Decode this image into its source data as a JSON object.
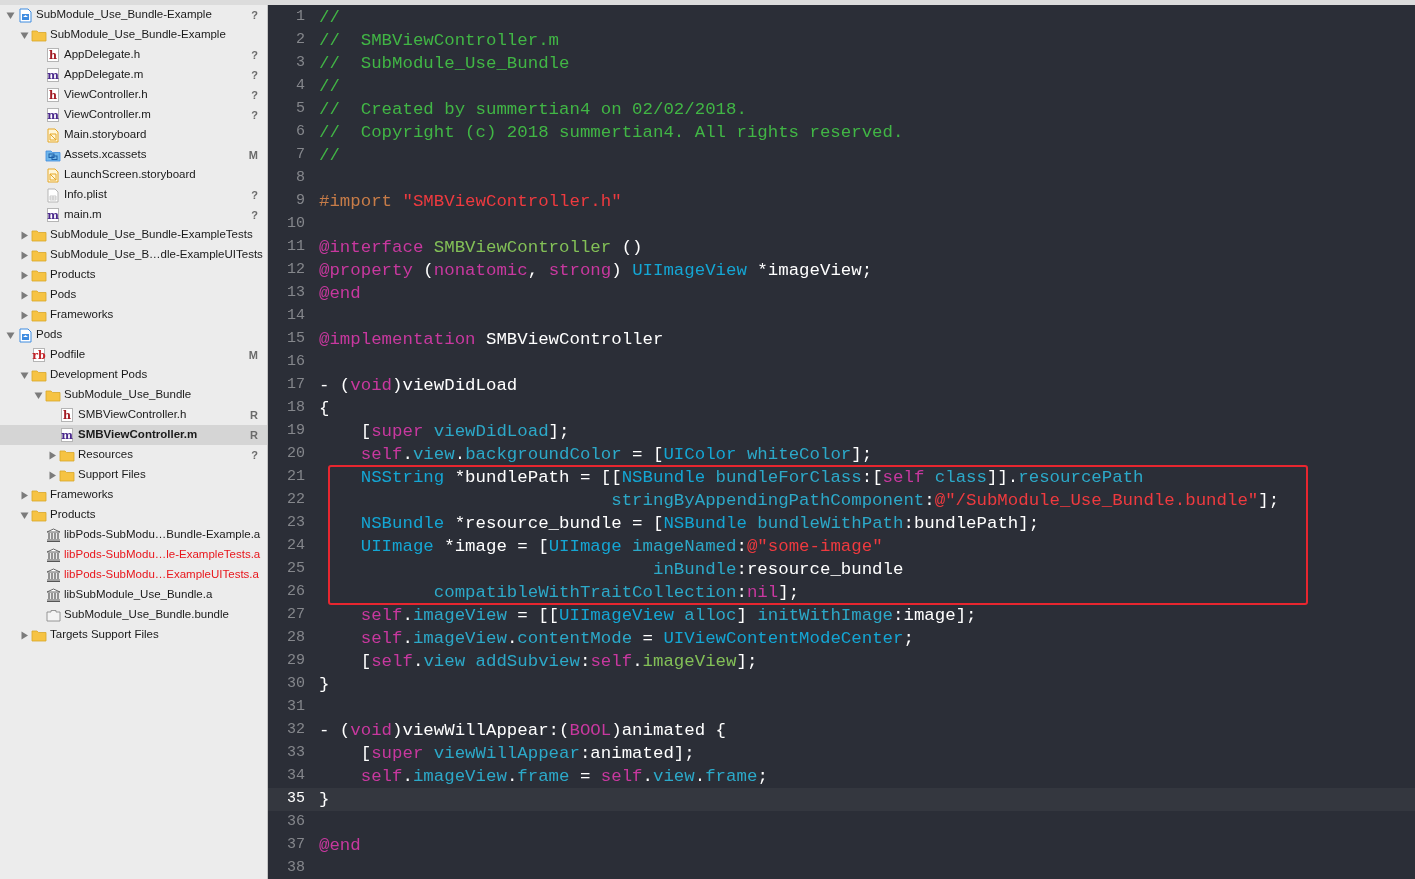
{
  "sidebar": {
    "items": [
      {
        "label": "SubModule_Use_Bundle-Example",
        "kind": "project",
        "badge": "?",
        "expanded": true,
        "selected": false,
        "children": [
          {
            "label": "SubModule_Use_Bundle-Example",
            "kind": "folder",
            "expanded": true,
            "selected": false,
            "children": [
              {
                "label": "AppDelegate.h",
                "kind": "h",
                "glyph": "h",
                "badge": "?",
                "selected": false
              },
              {
                "label": "AppDelegate.m",
                "kind": "m",
                "glyph": "m",
                "badge": "?",
                "selected": false
              },
              {
                "label": "ViewController.h",
                "kind": "h",
                "glyph": "h",
                "badge": "?",
                "selected": false
              },
              {
                "label": "ViewController.m",
                "kind": "m",
                "glyph": "m",
                "badge": "?",
                "selected": false
              },
              {
                "label": "Main.storyboard",
                "kind": "storyboard",
                "selected": false
              },
              {
                "label": "Assets.xcassets",
                "kind": "xcassets",
                "badge": "M",
                "selected": false
              },
              {
                "label": "LaunchScreen.storyboard",
                "kind": "storyboard",
                "selected": false
              },
              {
                "label": "Info.plist",
                "kind": "plist",
                "badge": "?",
                "selected": false
              },
              {
                "label": "main.m",
                "kind": "m",
                "glyph": "m",
                "badge": "?",
                "selected": false
              }
            ]
          },
          {
            "label": "SubModule_Use_Bundle-ExampleTests",
            "kind": "folder",
            "expanded": false,
            "selected": false
          },
          {
            "label": "SubModule_Use_B…dle-ExampleUITests",
            "kind": "folder",
            "expanded": false,
            "selected": false
          },
          {
            "label": "Products",
            "kind": "folder",
            "expanded": false,
            "selected": false
          },
          {
            "label": "Pods",
            "kind": "folder",
            "expanded": false,
            "selected": false
          },
          {
            "label": "Frameworks",
            "kind": "folder",
            "expanded": false,
            "selected": false
          }
        ]
      },
      {
        "label": "Pods",
        "kind": "project",
        "expanded": true,
        "selected": false,
        "children": [
          {
            "label": "Podfile",
            "kind": "rb",
            "glyph": "rb",
            "badge": "M",
            "selected": false
          },
          {
            "label": "Development Pods",
            "kind": "folder",
            "expanded": true,
            "selected": false,
            "children": [
              {
                "label": "SubModule_Use_Bundle",
                "kind": "folder",
                "expanded": true,
                "selected": false,
                "children": [
                  {
                    "label": "SMBViewController.h",
                    "kind": "h",
                    "glyph": "h",
                    "badge": "R",
                    "selected": false
                  },
                  {
                    "label": "SMBViewController.m",
                    "kind": "m",
                    "glyph": "m",
                    "badge": "R",
                    "selected": true
                  },
                  {
                    "label": "Resources",
                    "kind": "folder",
                    "badge": "?",
                    "expanded": false,
                    "selected": false
                  },
                  {
                    "label": "Support Files",
                    "kind": "folder",
                    "expanded": false,
                    "selected": false
                  }
                ]
              }
            ]
          },
          {
            "label": "Frameworks",
            "kind": "folder",
            "expanded": false,
            "selected": false
          },
          {
            "label": "Products",
            "kind": "folder",
            "expanded": true,
            "selected": false,
            "children": [
              {
                "label": "libPods-SubModu…Bundle-Example.a",
                "kind": "library",
                "missing": false,
                "selected": false
              },
              {
                "label": "libPods-SubModu…le-ExampleTests.a",
                "kind": "library",
                "missing": true,
                "selected": false
              },
              {
                "label": "libPods-SubModu…ExampleUITests.a",
                "kind": "library",
                "missing": true,
                "selected": false
              },
              {
                "label": "libSubModule_Use_Bundle.a",
                "kind": "library",
                "missing": false,
                "selected": false
              },
              {
                "label": "SubModule_Use_Bundle.bundle",
                "kind": "bundle",
                "missing": false,
                "selected": false
              }
            ]
          },
          {
            "label": "Targets Support Files",
            "kind": "folder",
            "expanded": false,
            "selected": false
          }
        ]
      }
    ]
  },
  "editor": {
    "blocks": [
      {
        "boxed": false,
        "lines": [
          {
            "number": "1",
            "current": false,
            "tokens": [
              {
                "kind": "comment",
                "text": "//"
              }
            ]
          },
          {
            "number": "2",
            "current": false,
            "tokens": [
              {
                "kind": "comment",
                "text": "//  SMBViewController.m"
              }
            ]
          },
          {
            "number": "3",
            "current": false,
            "tokens": [
              {
                "kind": "comment",
                "text": "//  SubModule_Use_Bundle"
              }
            ]
          },
          {
            "number": "4",
            "current": false,
            "tokens": [
              {
                "kind": "comment",
                "text": "//"
              }
            ]
          },
          {
            "number": "5",
            "current": false,
            "tokens": [
              {
                "kind": "comment",
                "text": "//  Created by summertian4 on 02/02/2018."
              }
            ]
          },
          {
            "number": "6",
            "current": false,
            "tokens": [
              {
                "kind": "comment",
                "text": "//  Copyright (c) 2018 summertian4. All rights reserved."
              }
            ]
          },
          {
            "number": "7",
            "current": false,
            "tokens": [
              {
                "kind": "comment",
                "text": "//"
              }
            ]
          },
          {
            "number": "8",
            "current": false
          },
          {
            "number": "9",
            "current": false,
            "tokens": [
              {
                "kind": "preprocessor",
                "text": "#import"
              },
              {
                "kind": "string",
                "text": " \"SMBViewController.h\""
              }
            ]
          },
          {
            "number": "10",
            "current": false
          },
          {
            "number": "11",
            "current": false,
            "tokens": [
              {
                "kind": "keyword",
                "text": "@interface"
              },
              {
                "kind": "project",
                "text": " SMBViewController"
              },
              {
                "kind": "plain",
                "text": " ()"
              }
            ]
          },
          {
            "number": "12",
            "current": false,
            "tokens": [
              {
                "kind": "keyword",
                "text": "@property"
              },
              {
                "kind": "plain",
                "text": " ("
              },
              {
                "kind": "keyword",
                "text": "nonatomic"
              },
              {
                "kind": "plain",
                "text": ", "
              },
              {
                "kind": "keyword",
                "text": "strong"
              },
              {
                "kind": "plain",
                "text": ") "
              },
              {
                "kind": "type",
                "text": "UIImageView"
              },
              {
                "kind": "plain",
                "text": " *imageView;"
              }
            ]
          },
          {
            "number": "13",
            "current": false,
            "tokens": [
              {
                "kind": "keyword",
                "text": "@end"
              }
            ]
          },
          {
            "number": "14",
            "current": false
          },
          {
            "number": "15",
            "current": false,
            "tokens": [
              {
                "kind": "keyword",
                "text": "@implementation"
              },
              {
                "kind": "plain",
                "text": " SMBViewController"
              }
            ]
          },
          {
            "number": "16",
            "current": false
          },
          {
            "number": "17",
            "current": false,
            "tokens": [
              {
                "kind": "plain",
                "text": "- ("
              },
              {
                "kind": "keyword",
                "text": "void"
              },
              {
                "kind": "plain",
                "text": ")viewDidLoad"
              }
            ]
          },
          {
            "number": "18",
            "current": false,
            "tokens": [
              {
                "kind": "plain",
                "text": "{"
              }
            ]
          },
          {
            "number": "19",
            "current": false,
            "tokens": [
              {
                "kind": "plain",
                "text": "    ["
              },
              {
                "kind": "keyword",
                "text": "super"
              },
              {
                "kind": "method",
                "text": " viewDidLoad"
              },
              {
                "kind": "plain",
                "text": "];"
              }
            ]
          },
          {
            "number": "20",
            "current": false,
            "tokens": [
              {
                "kind": "keyword",
                "text": "    self"
              },
              {
                "kind": "plain",
                "text": "."
              },
              {
                "kind": "method",
                "text": "view"
              },
              {
                "kind": "plain",
                "text": "."
              },
              {
                "kind": "method",
                "text": "backgroundColor"
              },
              {
                "kind": "plain",
                "text": " = ["
              },
              {
                "kind": "type",
                "text": "UIColor"
              },
              {
                "kind": "method",
                "text": " whiteColor"
              },
              {
                "kind": "plain",
                "text": "];"
              }
            ]
          }
        ]
      },
      {
        "boxed": true,
        "lines": [
          {
            "number": "21",
            "current": false,
            "tokens": [
              {
                "kind": "type",
                "text": "    NSString"
              },
              {
                "kind": "plain",
                "text": " *bundlePath = [["
              },
              {
                "kind": "type",
                "text": "NSBundle"
              },
              {
                "kind": "method",
                "text": " bundleForClass"
              },
              {
                "kind": "plain",
                "text": ":["
              },
              {
                "kind": "keyword",
                "text": "self"
              },
              {
                "kind": "method",
                "text": " class"
              },
              {
                "kind": "plain",
                "text": "]]."
              },
              {
                "kind": "method",
                "text": "resourcePath"
              }
            ]
          },
          {
            "number": "22",
            "current": false,
            "tokens": [
              {
                "kind": "method",
                "text": "                            stringByAppendingPathComponent"
              },
              {
                "kind": "plain",
                "text": ":"
              },
              {
                "kind": "string",
                "text": "@\"/SubModule_Use_Bundle.bundle\""
              },
              {
                "kind": "plain",
                "text": "];"
              }
            ]
          },
          {
            "number": "23",
            "current": false,
            "tokens": [
              {
                "kind": "type",
                "text": "    NSBundle"
              },
              {
                "kind": "plain",
                "text": " *resource_bundle = ["
              },
              {
                "kind": "type",
                "text": "NSBundle"
              },
              {
                "kind": "method",
                "text": " bundleWithPath"
              },
              {
                "kind": "plain",
                "text": ":bundlePath];"
              }
            ]
          },
          {
            "number": "24",
            "current": false,
            "tokens": [
              {
                "kind": "type",
                "text": "    UIImage"
              },
              {
                "kind": "plain",
                "text": " *image = ["
              },
              {
                "kind": "type",
                "text": "UIImage"
              },
              {
                "kind": "method",
                "text": " imageNamed"
              },
              {
                "kind": "plain",
                "text": ":"
              },
              {
                "kind": "string",
                "text": "@\"some-image\""
              }
            ]
          },
          {
            "number": "25",
            "current": false,
            "tokens": [
              {
                "kind": "method",
                "text": "                                inBundle"
              },
              {
                "kind": "plain",
                "text": ":resource_bundle"
              }
            ]
          },
          {
            "number": "26",
            "current": false,
            "tokens": [
              {
                "kind": "method",
                "text": "           compatibleWithTraitCollection"
              },
              {
                "kind": "plain",
                "text": ":"
              },
              {
                "kind": "keyword",
                "text": "nil"
              },
              {
                "kind": "plain",
                "text": "];"
              }
            ]
          }
        ]
      },
      {
        "boxed": false,
        "lines": [
          {
            "number": "27",
            "current": false,
            "tokens": [
              {
                "kind": "keyword",
                "text": "    self"
              },
              {
                "kind": "plain",
                "text": "."
              },
              {
                "kind": "method",
                "text": "imageView"
              },
              {
                "kind": "plain",
                "text": " = [["
              },
              {
                "kind": "type",
                "text": "UIImageView"
              },
              {
                "kind": "method",
                "text": " alloc"
              },
              {
                "kind": "plain",
                "text": "] "
              },
              {
                "kind": "method",
                "text": "initWithImage"
              },
              {
                "kind": "plain",
                "text": ":image];"
              }
            ]
          },
          {
            "number": "28",
            "current": false,
            "tokens": [
              {
                "kind": "keyword",
                "text": "    self"
              },
              {
                "kind": "plain",
                "text": "."
              },
              {
                "kind": "method",
                "text": "imageView"
              },
              {
                "kind": "plain",
                "text": "."
              },
              {
                "kind": "method",
                "text": "contentMode"
              },
              {
                "kind": "plain",
                "text": " = "
              },
              {
                "kind": "type",
                "text": "UIViewContentModeCenter"
              },
              {
                "kind": "plain",
                "text": ";"
              }
            ]
          },
          {
            "number": "29",
            "current": false,
            "tokens": [
              {
                "kind": "plain",
                "text": "    ["
              },
              {
                "kind": "keyword",
                "text": "self"
              },
              {
                "kind": "plain",
                "text": "."
              },
              {
                "kind": "method",
                "text": "view"
              },
              {
                "kind": "method",
                "text": " addSubview"
              },
              {
                "kind": "plain",
                "text": ":"
              },
              {
                "kind": "keyword",
                "text": "self"
              },
              {
                "kind": "plain",
                "text": "."
              },
              {
                "kind": "project",
                "text": "imageView"
              },
              {
                "kind": "plain",
                "text": "];"
              }
            ]
          },
          {
            "number": "30",
            "current": false,
            "tokens": [
              {
                "kind": "plain",
                "text": "}"
              }
            ]
          },
          {
            "number": "31",
            "current": false
          },
          {
            "number": "32",
            "current": false,
            "tokens": [
              {
                "kind": "plain",
                "text": "- ("
              },
              {
                "kind": "keyword",
                "text": "void"
              },
              {
                "kind": "plain",
                "text": ")viewWillAppear:("
              },
              {
                "kind": "keyword",
                "text": "BOOL"
              },
              {
                "kind": "plain",
                "text": ")animated {"
              }
            ]
          },
          {
            "number": "33",
            "current": false,
            "tokens": [
              {
                "kind": "plain",
                "text": "    ["
              },
              {
                "kind": "keyword",
                "text": "super"
              },
              {
                "kind": "method",
                "text": " viewWillAppear"
              },
              {
                "kind": "plain",
                "text": ":animated];"
              }
            ]
          },
          {
            "number": "34",
            "current": false,
            "tokens": [
              {
                "kind": "keyword",
                "text": "    self"
              },
              {
                "kind": "plain",
                "text": "."
              },
              {
                "kind": "method",
                "text": "imageView"
              },
              {
                "kind": "plain",
                "text": "."
              },
              {
                "kind": "method",
                "text": "frame"
              },
              {
                "kind": "plain",
                "text": " = "
              },
              {
                "kind": "keyword",
                "text": "self"
              },
              {
                "kind": "plain",
                "text": "."
              },
              {
                "kind": "method",
                "text": "view"
              },
              {
                "kind": "plain",
                "text": "."
              },
              {
                "kind": "method",
                "text": "frame"
              },
              {
                "kind": "plain",
                "text": ";"
              }
            ]
          },
          {
            "number": "35",
            "current": true,
            "tokens": [
              {
                "kind": "plain",
                "text": "}"
              }
            ]
          },
          {
            "number": "36",
            "current": false
          },
          {
            "number": "37",
            "current": false,
            "tokens": [
              {
                "kind": "keyword",
                "text": "@end"
              }
            ]
          },
          {
            "number": "38",
            "current": false
          }
        ]
      }
    ]
  }
}
